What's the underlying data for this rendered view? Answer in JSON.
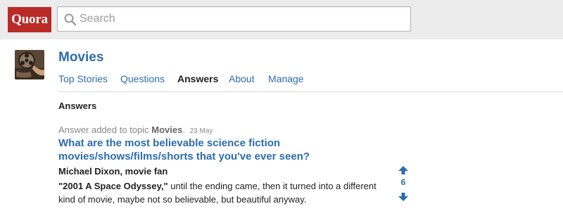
{
  "header": {
    "logo_text": "Quora",
    "search": {
      "placeholder": "Search",
      "value": ""
    },
    "colors": {
      "logo_bg": "#b92b27",
      "bar_bg": "#ececec"
    }
  },
  "topic": {
    "title": "Movies",
    "image": "film-reel-image",
    "tabs": [
      {
        "label": "Top Stories",
        "active": false
      },
      {
        "label": "Questions",
        "active": false
      },
      {
        "label": "Answers",
        "active": true
      },
      {
        "label": "About",
        "active": false
      },
      {
        "label": "Manage",
        "active": false
      }
    ]
  },
  "section": {
    "heading": "Answers"
  },
  "feed_item": {
    "meta_prefix": "Answer added to topic",
    "topic_link": "Movies",
    "meta_sep": ".",
    "date": "23 May",
    "question": "What are the most believable science fiction movies/shows/films/shorts that you've ever seen?",
    "author": "Michael Dixon, movie fan",
    "answer_bold": "\"2001 A Space Odyssey,\"",
    "answer_text": " until the ending came, then it turned into a different kind of movie, maybe not so believable, but beautiful anyway.",
    "upvotes": "6",
    "icons": {
      "upvote": "upvote-arrow-icon",
      "downvote": "downvote-arrow-icon"
    }
  },
  "accent_color": "#2b6dad"
}
